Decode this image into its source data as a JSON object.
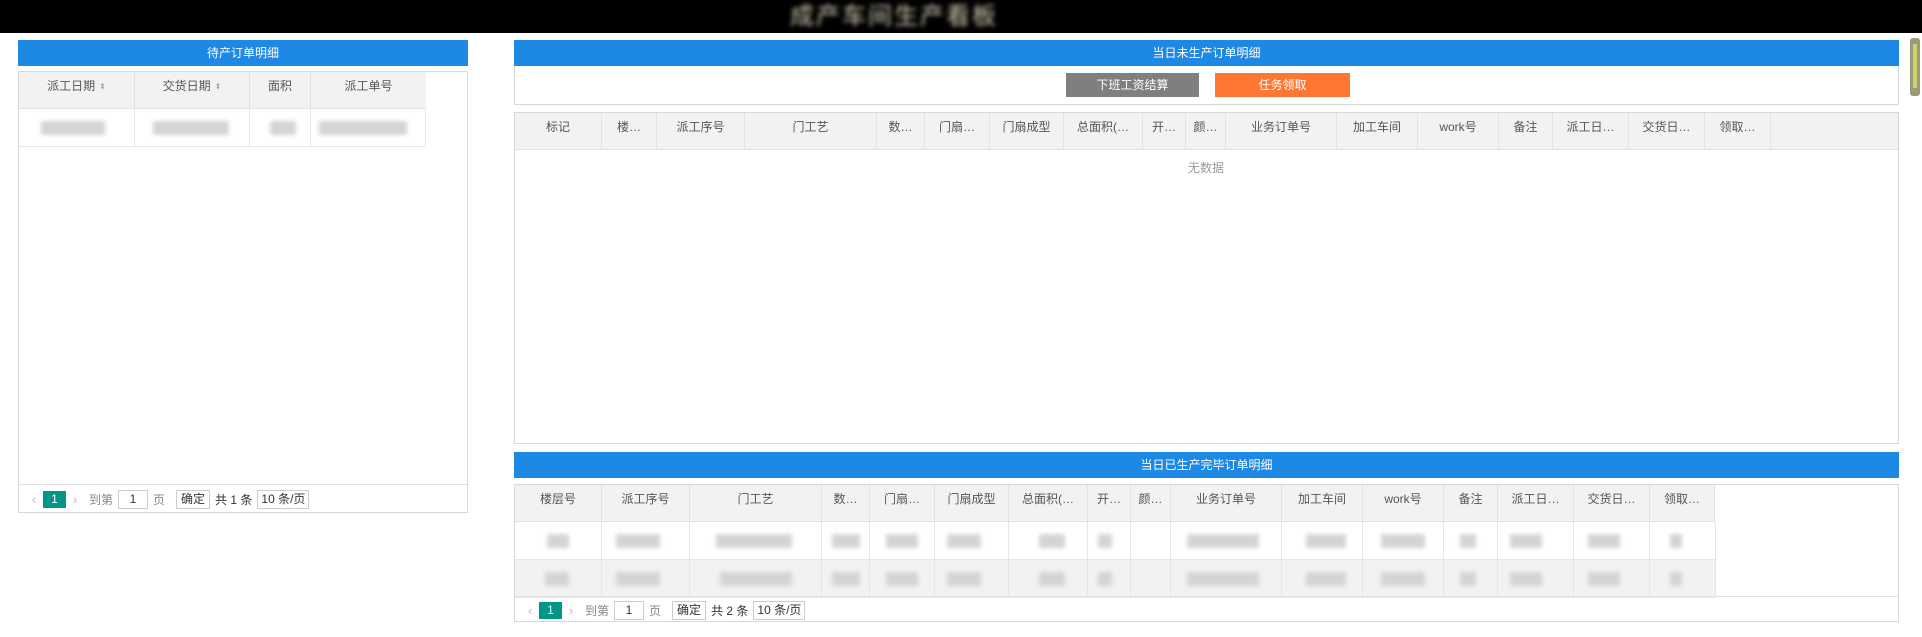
{
  "header": {
    "title": "成产车间生产看板"
  },
  "pending": {
    "title": "待产订单明细",
    "columns": [
      "派工日期",
      "交货日期",
      "面积",
      "派工单号"
    ],
    "pagination": {
      "page": "1",
      "goto": "到第",
      "page_input": "1",
      "page_unit": "页",
      "confirm": "确定",
      "total": "共 1 条",
      "page_size": "10 条/页"
    }
  },
  "unproduced": {
    "title": "当日未生产订单明细",
    "buttons": {
      "settle": "下班工资结算",
      "claim": "任务领取"
    },
    "colors": {
      "settle": "#7f7f7f",
      "claim": "#ff7733"
    },
    "columns": [
      "标记",
      "楼…",
      "派工序号",
      "门工艺",
      "数…",
      "门扇…",
      "门扇成型",
      "总面积(…",
      "开…",
      "颜…",
      "业务订单号",
      "加工车间",
      "work号",
      "备注",
      "派工日…",
      "交货日…",
      "领取…"
    ],
    "empty": "无数据"
  },
  "completed": {
    "title": "当日已生产完毕订单明细",
    "columns": [
      "楼层号",
      "派工序号",
      "门工艺",
      "数…",
      "门扇…",
      "门扇成型",
      "总面积(…",
      "开…",
      "颜…",
      "业务订单号",
      "加工车间",
      "work号",
      "备注",
      "派工日…",
      "交货日…",
      "领取…"
    ],
    "pagination": {
      "page": "1",
      "goto": "到第",
      "page_input": "1",
      "page_unit": "页",
      "confirm": "确定",
      "total": "共 2 条",
      "page_size": "10 条/页"
    }
  },
  "accent_color": "#1e88e5"
}
